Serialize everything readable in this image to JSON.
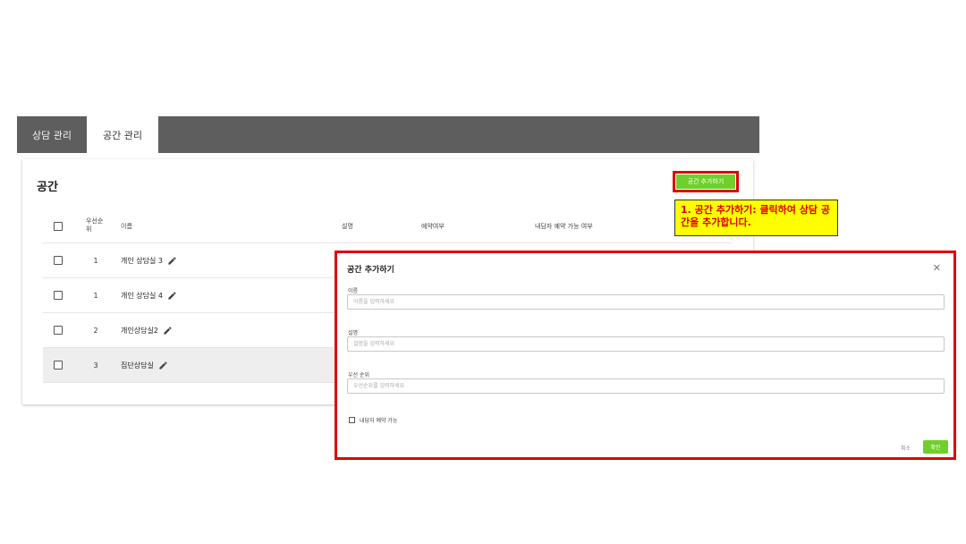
{
  "tabs": [
    {
      "label": "상담 관리",
      "active": false
    },
    {
      "label": "공간 관리",
      "active": true
    }
  ],
  "section": {
    "title": "공간",
    "add_button_label": "공간 추가하기"
  },
  "table": {
    "headers": {
      "priority": "우선순위",
      "name": "이름",
      "description": "설명",
      "reservation": "예약여부",
      "internal_reservation": "내담자 예약 가능 여부"
    },
    "rows": [
      {
        "priority": "1",
        "name": "개인 상담실 3"
      },
      {
        "priority": "1",
        "name": "개인 상담실 4"
      },
      {
        "priority": "2",
        "name": "개인상담실2"
      },
      {
        "priority": "3",
        "name": "집단상담실"
      }
    ]
  },
  "annotation": {
    "text": "1. 공간 추가하기: 클릭하여 상담 공간을 추가합니다."
  },
  "modal": {
    "title": "공간 추가하기",
    "name_label": "이름",
    "name_placeholder": "이름을 입력하세요",
    "desc_label": "설명",
    "desc_placeholder": "설명을 입력하세요",
    "priority_label": "우선 순위",
    "priority_placeholder": "우선순위를 입력하세요",
    "checkbox_label": "내담자 예약 가능",
    "cancel_label": "취소",
    "confirm_label": "확인"
  },
  "colors": {
    "accent_green": "#6fcf2b",
    "highlight_red": "#e00000",
    "note_yellow": "#ffff00",
    "tabbar_gray": "#5e5e5e"
  },
  "icons": {
    "edit": "pencil-icon",
    "close": "close-icon",
    "checkbox": "checkbox-icon"
  }
}
